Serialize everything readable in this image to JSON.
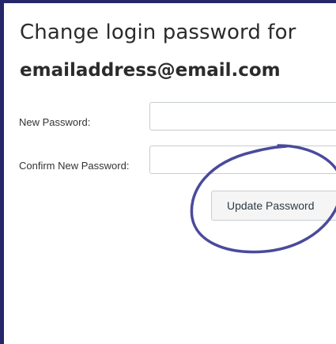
{
  "form": {
    "title_line1": "Change login password for",
    "title_line2": "emailaddress@email.com",
    "new_password_label": "New Password:",
    "new_password_value": "",
    "confirm_password_label": "Confirm New Password:",
    "confirm_password_value": "",
    "submit_label": "Update Password"
  },
  "colors": {
    "background": "#252769",
    "panel": "#ffffff",
    "annotation_ink": "#4a4a9c",
    "button_bg": "#f5f5f5",
    "input_border": "#c7cdd1"
  },
  "annotation": {
    "shape": "hand-drawn circle",
    "target": "update-password-button"
  }
}
